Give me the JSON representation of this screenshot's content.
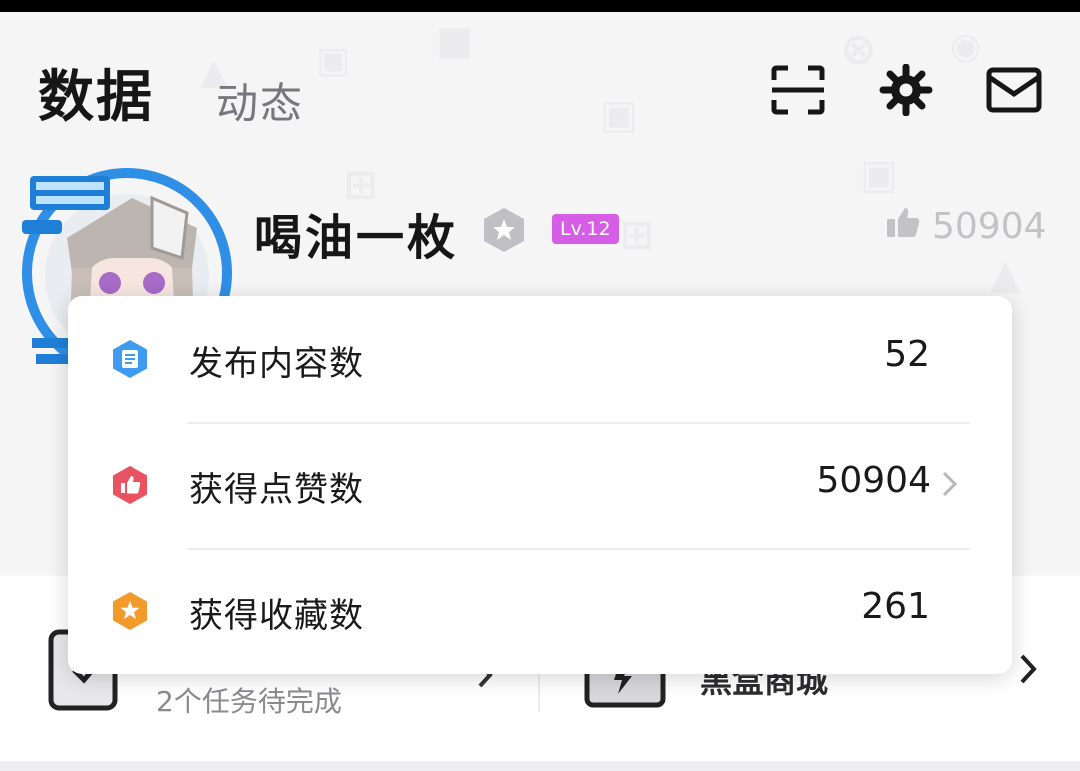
{
  "header": {
    "tabs": [
      {
        "label": "数据",
        "active": true
      },
      {
        "label": "动态",
        "active": false
      }
    ],
    "icons": [
      "scan-icon",
      "gear-icon",
      "mail-icon"
    ]
  },
  "profile": {
    "name": "喝油一枚",
    "level": "Lv.12",
    "likes": "50904"
  },
  "stats_popup": {
    "rows": [
      {
        "label": "发布内容数",
        "value": "52",
        "icon": "document-icon",
        "color": "#3f9bf0",
        "chevron": false
      },
      {
        "label": "获得点赞数",
        "value": "50904",
        "icon": "thumbs-up-icon",
        "color": "#e95260",
        "chevron": true
      },
      {
        "label": "获得收藏数",
        "value": "261",
        "icon": "star-icon",
        "color": "#f29a2a",
        "chevron": false
      }
    ]
  },
  "bottom": {
    "tasks_text": "2个任务待完成",
    "shop_text": "黑盒商城"
  },
  "colors": {
    "level_badge": "#d65ee6",
    "avatar_ring": "#2f8fe6"
  }
}
